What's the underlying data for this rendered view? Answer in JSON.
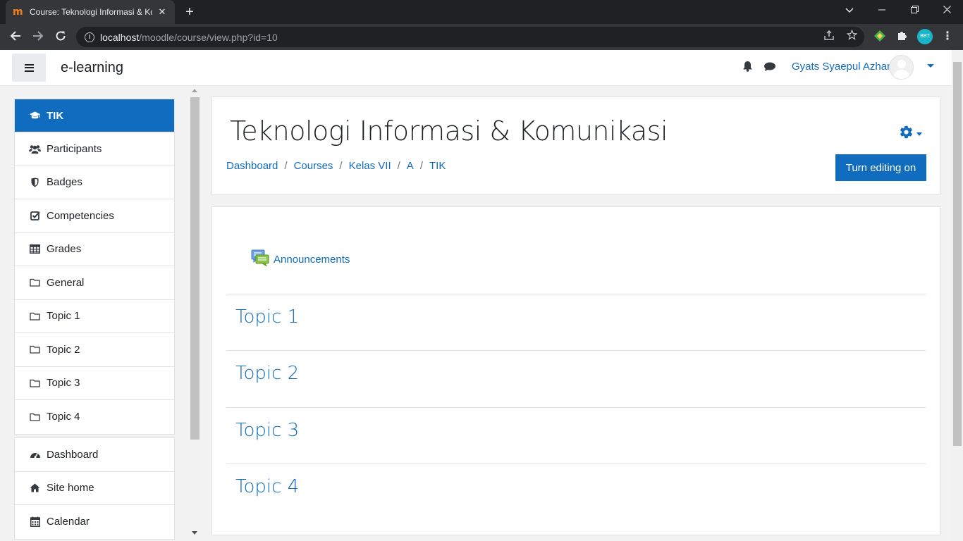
{
  "browser": {
    "tab_title": "Course: Teknologi Informasi & Ko",
    "tab_close": "✕",
    "new_tab": "+",
    "url_host": "localhost",
    "url_path": "/moodle/course/view.php?id=10",
    "ext_avatar_text": "BBT"
  },
  "navbar": {
    "brand": "e-learning",
    "user_name": "Gyats Syaepul Azhar"
  },
  "drawer": {
    "course_items": [
      {
        "label": "TIK",
        "icon": "graduation-cap-icon"
      },
      {
        "label": "Participants",
        "icon": "users-icon"
      },
      {
        "label": "Badges",
        "icon": "shield-icon"
      },
      {
        "label": "Competencies",
        "icon": "check-square-icon"
      },
      {
        "label": "Grades",
        "icon": "table-icon"
      },
      {
        "label": "General",
        "icon": "folder-icon"
      },
      {
        "label": "Topic 1",
        "icon": "folder-icon"
      },
      {
        "label": "Topic 2",
        "icon": "folder-icon"
      },
      {
        "label": "Topic 3",
        "icon": "folder-icon"
      },
      {
        "label": "Topic 4",
        "icon": "folder-icon"
      }
    ],
    "site_items": [
      {
        "label": "Dashboard",
        "icon": "tachometer-icon"
      },
      {
        "label": "Site home",
        "icon": "home-icon"
      },
      {
        "label": "Calendar",
        "icon": "calendar-icon"
      }
    ]
  },
  "header": {
    "course_title": "Teknologi Informasi & Komunikasi",
    "breadcrumb": [
      "Dashboard",
      "Courses",
      "Kelas VII",
      "A",
      "TIK"
    ],
    "breadcrumb_separator": "/",
    "edit_button": "Turn editing on"
  },
  "content": {
    "announcements_label": "Announcements",
    "sections": [
      "Topic 1",
      "Topic 2",
      "Topic 3",
      "Topic 4"
    ]
  },
  "colors": {
    "primary": "#0f6cbf",
    "text": "#1d2125",
    "border": "#dee2e6"
  }
}
